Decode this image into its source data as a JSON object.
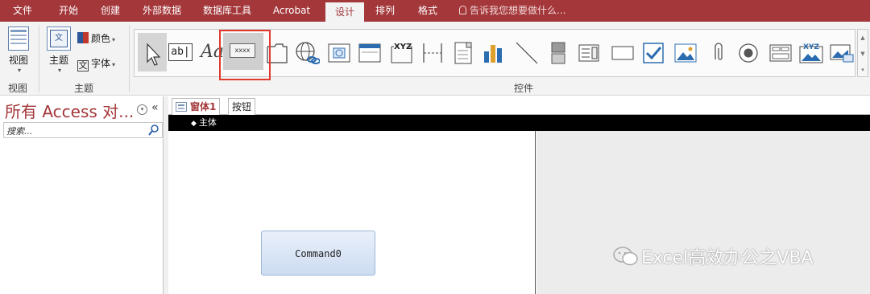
{
  "ribbon_tabs": [
    {
      "label": "文件"
    },
    {
      "label": "开始"
    },
    {
      "label": "创建"
    },
    {
      "label": "外部数据"
    },
    {
      "label": "数据库工具"
    },
    {
      "label": "Acrobat"
    },
    {
      "label": "设计",
      "active": true
    },
    {
      "label": "排列"
    },
    {
      "label": "格式"
    }
  ],
  "tell_me": "告诉我您想要做什么...",
  "views_group": {
    "button_label": "视图",
    "group_label": "视图"
  },
  "themes_group": {
    "theme_label": "主题",
    "colors_label": "颜色",
    "fonts_label": "字体",
    "group_label": "主题"
  },
  "controls_group": {
    "group_label": "控件",
    "textbox_sample": "ab|",
    "label_sample": "Aa",
    "button_sample": "xxxx",
    "xyz_sample": "XYZ",
    "items": [
      "select-pointer",
      "text-box",
      "label",
      "button",
      "tab-control",
      "hyperlink",
      "web-browser",
      "navigation",
      "option-group",
      "page-break",
      "combo-box",
      "chart",
      "line",
      "toggle-button",
      "list-box",
      "rectangle",
      "check-box",
      "image",
      "attachment",
      "option-button",
      "subform",
      "bound-object-frame",
      "insert-image"
    ]
  },
  "nav_pane": {
    "title": "所有 Access 对...",
    "collapse": "«",
    "search_placeholder": "搜索..."
  },
  "document": {
    "tabs": [
      {
        "label": "窗体1",
        "active": true
      },
      {
        "label": "按钮"
      }
    ],
    "section": "主体",
    "command_button": "Command0"
  },
  "watermark": "Excel高效办公之VBA",
  "colors": {
    "accent": "#a4373a",
    "highlight_box": "#e03b2e"
  }
}
